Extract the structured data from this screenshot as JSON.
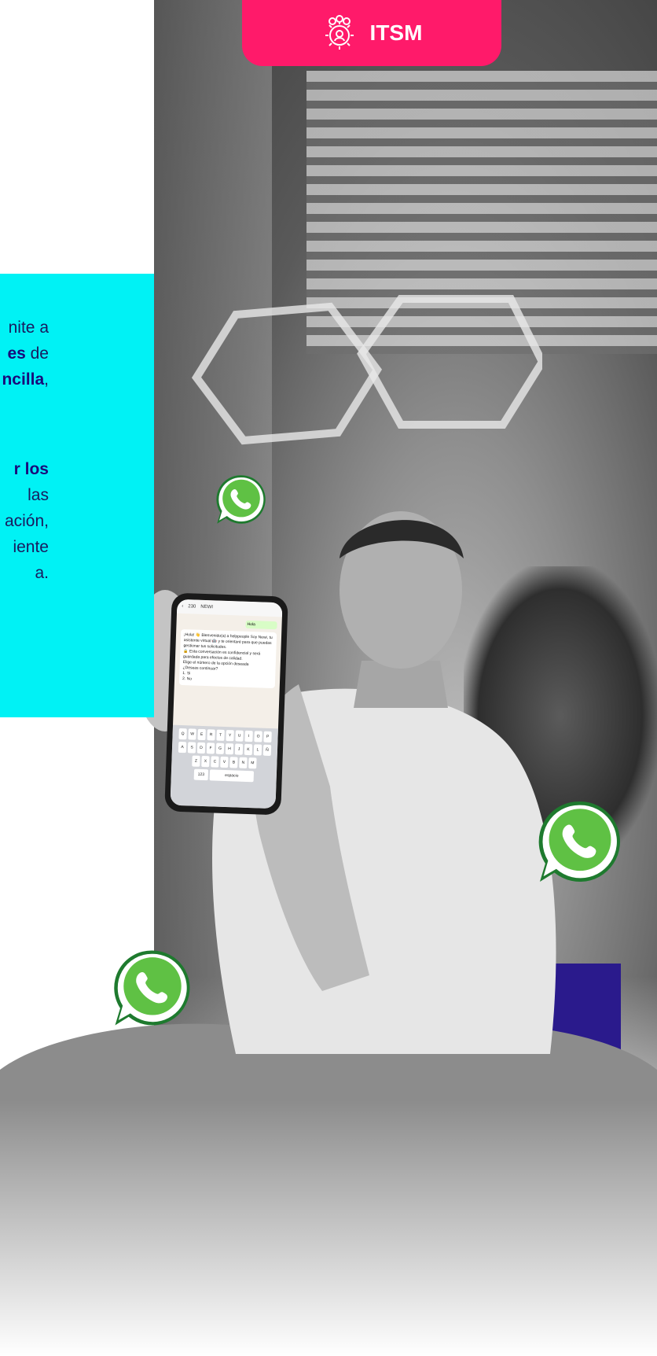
{
  "badge": {
    "label": "ITSM",
    "icon": "team-gear-icon",
    "color": "#ff1a6a"
  },
  "intro_panel": {
    "color": "#00f2f5",
    "paragraph_1": [
      {
        "text": "nite a",
        "bold": false
      },
      {
        "text": "es",
        "bold": true
      },
      {
        "text": " de",
        "bold": false
      },
      {
        "text": "ncilla",
        "bold": true
      },
      {
        "text": ",",
        "bold": false
      }
    ],
    "paragraph_2_lines": [
      "r los",
      "las",
      "ación,",
      "iente",
      "a."
    ]
  },
  "phone_screen": {
    "contact": "NEWI",
    "back_label": "230",
    "sent": "Hola",
    "greeting": "¡Hola! 👋 Bienvenido(a) a helppeople Soy Newi, tu asistente virtual 🤖 y te orientaré para que puedas gestionar tus solicitudes.",
    "privacy": "🔒 Esta conversación es confidencial y será guardada para efectos de calidad.",
    "prompt": "Elige el número de la opción deseada",
    "question": "¿Deseas continuar?",
    "options": [
      "1. Si",
      "2. No"
    ],
    "keyboard_rows": [
      [
        "Q",
        "W",
        "E",
        "R",
        "T",
        "Y",
        "U",
        "I",
        "O",
        "P"
      ],
      [
        "A",
        "S",
        "D",
        "F",
        "G",
        "H",
        "J",
        "K",
        "L",
        "Ñ"
      ],
      [
        "Z",
        "X",
        "C",
        "V",
        "B",
        "N",
        "M"
      ]
    ],
    "space_label": "espacio",
    "numbers_label": "123"
  },
  "icons": [
    "whatsapp-icon",
    "whatsapp-icon",
    "whatsapp-icon"
  ]
}
